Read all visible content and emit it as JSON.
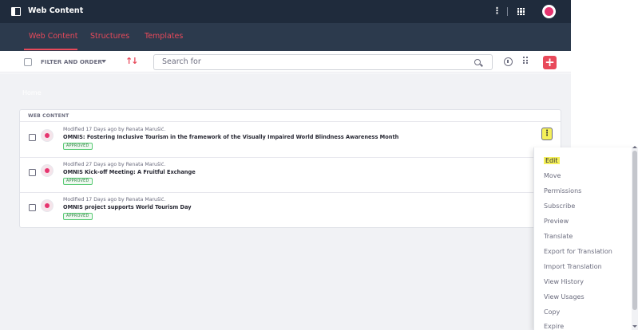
{
  "header": {
    "title": "Web Content",
    "kebab_icon": "vertical-ellipsis-icon",
    "apps_icon": "grid-icon",
    "avatar_color": "#e6346f"
  },
  "nav": {
    "tabs": [
      {
        "label": "Web Content",
        "active": true
      },
      {
        "label": "Structures",
        "active": false
      },
      {
        "label": "Templates",
        "active": false
      }
    ],
    "accent": "#e8495a"
  },
  "toolbar": {
    "filter_label": "FILTER AND ORDER",
    "sort_glyph": "↑↓",
    "search_placeholder": "Search for",
    "add_label": "+"
  },
  "breadcrumb": "Home",
  "list": {
    "header": "WEB CONTENT",
    "items": [
      {
        "meta": "Modified 17 Days ago by Renata Marušić.",
        "title": "OMNIS: Fostering Inclusive Tourism in the framework of the Visually Impaired World Blindness Awareness Month",
        "status": "APPROVED"
      },
      {
        "meta": "Modified 27 Days ago by Renata Marušić.",
        "title": "OMNIS Kick-off Meeting: A Fruitful Exchange",
        "status": "APPROVED"
      },
      {
        "meta": "Modified 17 Days ago by Renata Marušić.",
        "title": "OMNIS project supports World Tourism Day",
        "status": "APPROVED"
      }
    ],
    "kebab_glyph": "⋮"
  },
  "menu": {
    "items": [
      "Edit",
      "Move",
      "Permissions",
      "Subscribe",
      "Preview",
      "Translate",
      "Export for Translation",
      "Import Translation",
      "View History",
      "View Usages",
      "Copy",
      "Expire"
    ],
    "highlight": "Edit",
    "highlight_color": "#f5f05a"
  }
}
